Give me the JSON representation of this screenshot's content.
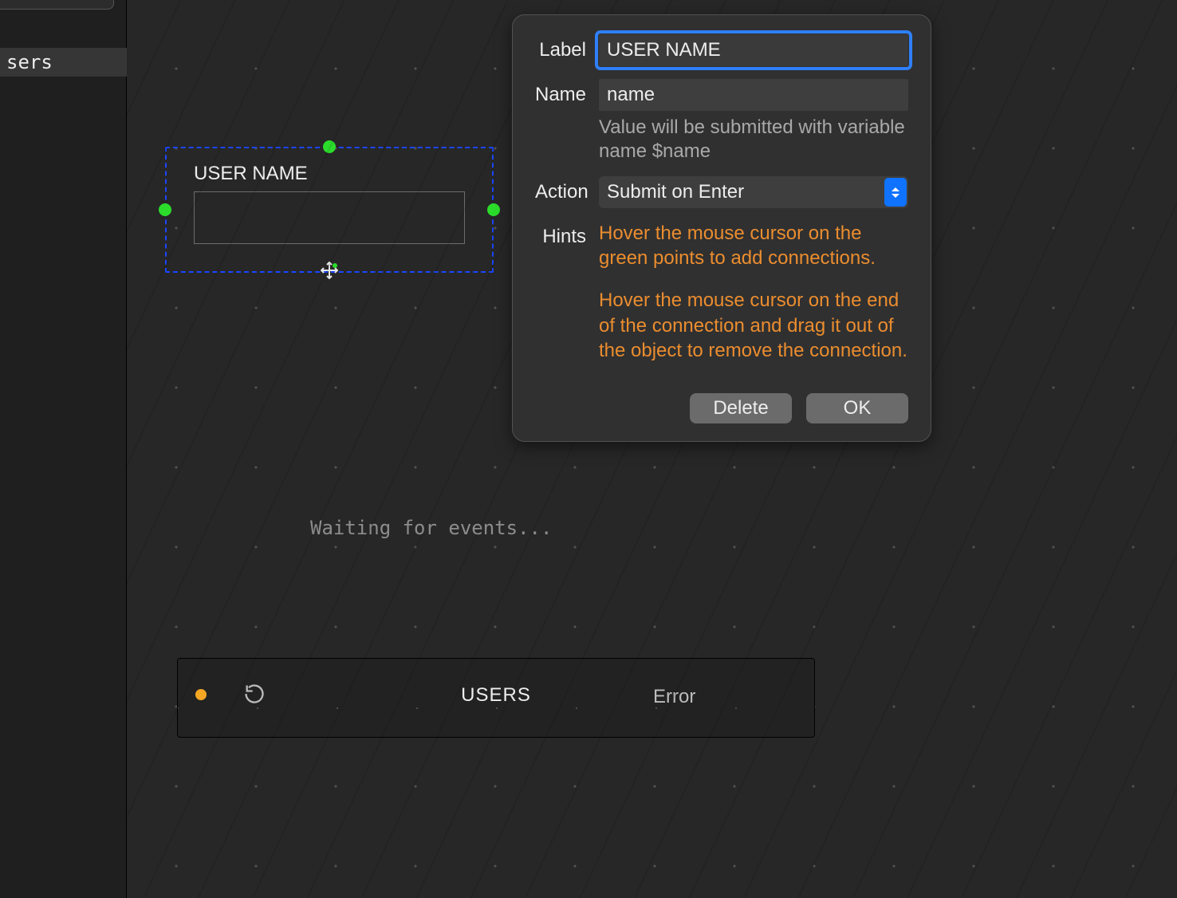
{
  "sidebar": {
    "items": [
      "sers"
    ]
  },
  "node": {
    "label": "USER NAME"
  },
  "panel": {
    "rows": {
      "label": {
        "label": "Label",
        "value": "USER NAME"
      },
      "name": {
        "label": "Name",
        "value": "name",
        "helper": "Value will be submitted with variable name $name"
      },
      "action": {
        "label": "Action",
        "value": "Submit on Enter"
      },
      "hints": {
        "label": "Hints",
        "p1": "Hover the mouse cursor on the green points to add connections.",
        "p2": "Hover the mouse cursor on the end of the connection and drag it out of the object to remove the connection."
      }
    },
    "buttons": {
      "delete": "Delete",
      "ok": "OK"
    }
  },
  "waiting": "Waiting for events...",
  "thumb": {
    "title": "USERS",
    "error": "Error"
  }
}
